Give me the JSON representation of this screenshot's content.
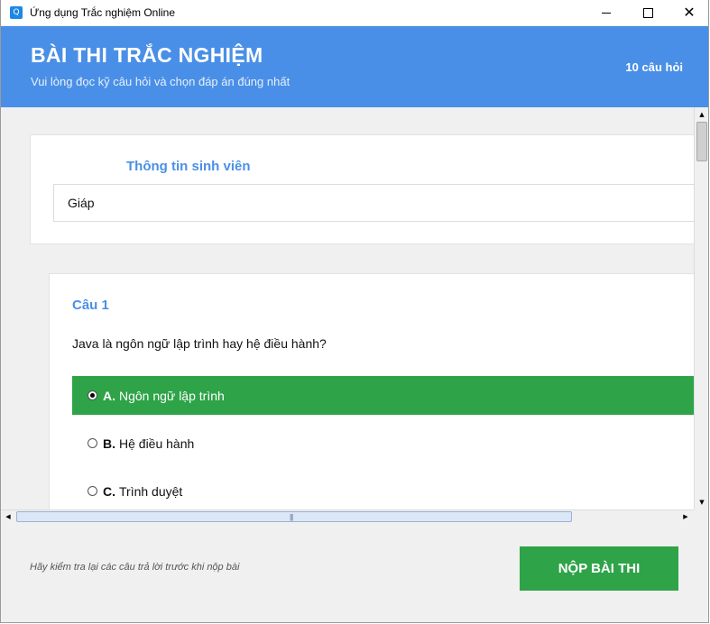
{
  "window": {
    "title": "Ứng dụng Trắc nghiệm Online",
    "icon": "Q"
  },
  "header": {
    "title": "BÀI THI TRẮC NGHIỆM",
    "subtitle": "Vui lòng đọc kỹ câu hỏi và chọn đáp án đúng nhất",
    "question_count": "10 câu hỏi"
  },
  "student": {
    "heading": "Thông tin sinh viên",
    "name_value": "Giáp"
  },
  "question": {
    "number": "Câu 1",
    "text": "Java là ngôn ngữ lập trình hay hệ điều hành?",
    "options": [
      {
        "letter": "A.",
        "text": "Ngôn ngữ lập trình",
        "selected": true
      },
      {
        "letter": "B.",
        "text": "Hệ điều hành",
        "selected": false
      },
      {
        "letter": "C.",
        "text": "Trình duyệt",
        "selected": false
      }
    ]
  },
  "footer": {
    "note": "Hãy kiểm tra lại các câu trả lời trước khi nộp bài",
    "submit_label": "NỘP BÀI THI"
  },
  "colors": {
    "accent_blue": "#4a8fe7",
    "accent_green": "#2ea348"
  }
}
